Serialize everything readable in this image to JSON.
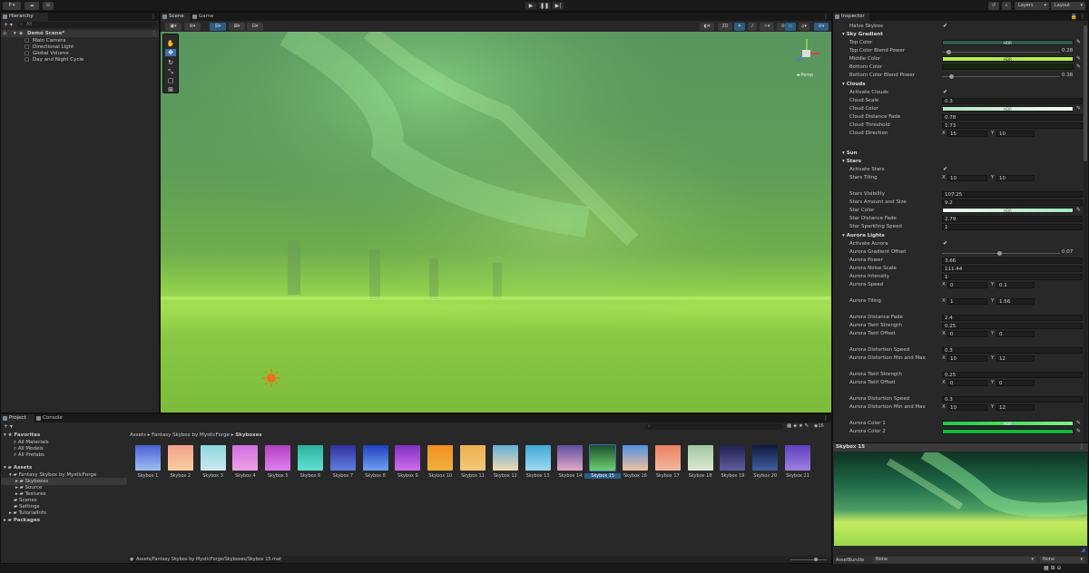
{
  "toolbar": {
    "account_label": "P",
    "layers_label": "Layers",
    "layout_label": "Layout"
  },
  "hierarchy": {
    "tab": "Hierarchy",
    "search_placeholder": "All",
    "scene": "Demo Scene*",
    "items": [
      "Main Camera",
      "Directional Light",
      "Global Volume",
      "Day and Night Cycle"
    ]
  },
  "scene_tabs": {
    "scene": "Scene",
    "game": "Game"
  },
  "scene_toolbar": {
    "mode_2d": "2D",
    "orient": "◄ Persp"
  },
  "project": {
    "tabs": [
      "Project",
      "Console"
    ],
    "favorites_label": "Favorites",
    "favorites": [
      "All Materials",
      "All Models",
      "All Prefabs"
    ],
    "assets_label": "Assets",
    "assets_tree": [
      "Fantasy Skybox by MysticForge",
      "Skyboxes",
      "Source",
      "Textures",
      "Scenes",
      "Settings",
      "TutorialInfo"
    ],
    "packages_label": "Packages",
    "breadcrumb": [
      "Assets",
      "Fantasy Skybox by MysticForge",
      "Skyboxes"
    ],
    "hidden_count": "16",
    "status_path": "Assets/Fantasy Skybox by MysticForge/Skyboxes/Skybox 15.mat"
  },
  "skyboxes": [
    {
      "name": "Skybox 1",
      "c1": "#4a60d8",
      "c2": "#9cc0f0"
    },
    {
      "name": "Skybox 2",
      "c1": "#f4a08a",
      "c2": "#f7d0a0"
    },
    {
      "name": "Skybox 3",
      "c1": "#8ad8e0",
      "c2": "#d0e8f0"
    },
    {
      "name": "Skybox 4",
      "c1": "#d070e0",
      "c2": "#f0a0e8"
    },
    {
      "name": "Skybox 5",
      "c1": "#b040c0",
      "c2": "#e080f0"
    },
    {
      "name": "Skybox 6",
      "c1": "#30b0a0",
      "c2": "#60e0d0"
    },
    {
      "name": "Skybox 7",
      "c1": "#3030a0",
      "c2": "#6080e0"
    },
    {
      "name": "Skybox 8",
      "c1": "#2040c0",
      "c2": "#70a0f0"
    },
    {
      "name": "Skybox 9",
      "c1": "#8030c0",
      "c2": "#d070f0"
    },
    {
      "name": "Skybox 10",
      "c1": "#f09020",
      "c2": "#f0b040"
    },
    {
      "name": "Skybox 11",
      "c1": "#f0b050",
      "c2": "#f0c878"
    },
    {
      "name": "Skybox 12",
      "c1": "#60b0d8",
      "c2": "#f0d8b0"
    },
    {
      "name": "Skybox 13",
      "c1": "#40a8d8",
      "c2": "#a0d8f0"
    },
    {
      "name": "Skybox 14",
      "c1": "#6050a0",
      "c2": "#e0a8c8"
    },
    {
      "name": "Skybox 15",
      "c1": "#1a5030",
      "c2": "#70d070"
    },
    {
      "name": "Skybox 16",
      "c1": "#5090e0",
      "c2": "#f0c0a0"
    },
    {
      "name": "Skybox 17",
      "c1": "#f08060",
      "c2": "#f0b8a0"
    },
    {
      "name": "Skybox 18",
      "c1": "#a0c8a0",
      "c2": "#e0e8d0"
    },
    {
      "name": "Skybox 19",
      "c1": "#202050",
      "c2": "#6060a0"
    },
    {
      "name": "Skybox 20",
      "c1": "#101840",
      "c2": "#4060a0"
    },
    {
      "name": "Skybox 21",
      "c1": "#6040c0",
      "c2": "#a080e0"
    }
  ],
  "inspector": {
    "tab": "Inspector",
    "halve": "Halve Skybox",
    "sky_gradient": "Sky Gradient",
    "top_color": "Top Color",
    "top_color_hdr": "HDR",
    "top_blend": "Top Color Blend Power",
    "top_blend_val": "0.28",
    "top_blend_frac": 0.04,
    "middle_color": "Middle Color",
    "middle_color_hdr": "HDR",
    "bottom_color": "Bottom Color",
    "bottom_blend": "Bottom Color Blend Power",
    "bottom_blend_val": "0.38",
    "bottom_blend_frac": 0.06,
    "clouds": "Clouds",
    "activate_clouds": "Activate Clouds",
    "cloud_scale": "Cloud Scale",
    "cloud_scale_val": "0.3",
    "cloud_color": "Cloud Color",
    "cloud_color_hdr": "HDR",
    "cloud_fade": "Cloud Distance Fade",
    "cloud_fade_val": "0.78",
    "cloud_threshold": "Cloud Threshold",
    "cloud_threshold_val": "1.73",
    "cloud_dir": "Cloud Direction",
    "cloud_dir_x": "15",
    "cloud_dir_y": "10",
    "sun": "Sun",
    "stars": "Stars",
    "activate_stars": "Activate Stars",
    "stars_tiling": "Stars Tiling",
    "stars_tiling_x": "10",
    "stars_tiling_y": "10",
    "stars_visibility": "Stars Visibility",
    "stars_visibility_val": "107.25",
    "stars_amount": "Stars Amount and Size",
    "stars_amount_val": "9.2",
    "star_color": "Star Color",
    "star_color_hdr": "HDR",
    "star_fade": "Star Distance Fade",
    "star_fade_val": "2.79",
    "star_sparkle": "Star Sparkling Speed",
    "star_sparkle_val": "1",
    "aurora_lights": "Aurora Lights",
    "activate_aurora": "Activate Aurora",
    "aurora_grad": "Aurora Gradient Offset",
    "aurora_grad_val": "0.07",
    "aurora_grad_frac": 0.47,
    "aurora_power": "Aurora Power",
    "aurora_power_val": "3.66",
    "aurora_noise": "Aurora Noise Scale",
    "aurora_noise_val": "111.44",
    "aurora_intensity": "Aurora Intensity",
    "aurora_intensity_val": "1",
    "aurora_speed": "Aurora Speed",
    "aurora_speed_x": "0",
    "aurora_speed_y": "0.1",
    "aurora_tiling": "Aurora Tiling",
    "aurora_tiling_x": "1",
    "aurora_tiling_y": "1.56",
    "aurora_fade": "Aurora Distance Fade",
    "aurora_fade_val": "2.4",
    "aurora_twirl": "Aurora Twirl Strength",
    "aurora_twirl_val": "0.25",
    "aurora_twirl_off": "Aurora Twirl Offset",
    "aurora_twirl_off_x": "0",
    "aurora_twirl_off_y": "0",
    "aurora_dist_speed": "Aurora Distortion Speed",
    "aurora_dist_speed_val": "0.3",
    "aurora_dist_mm": "Aurora Distortion Min and Max",
    "aurora_dist_mm_x": "10",
    "aurora_dist_mm_y": "12",
    "aurora_twirl2": "Aurora Twirl Strength",
    "aurora_twirl2_val": "0.25",
    "aurora_twirl_off2": "Aurora Twirl Offset",
    "aurora_twirl_off2_x": "0",
    "aurora_twirl_off2_y": "0",
    "aurora_dist_speed2": "Aurora Distortion Speed",
    "aurora_dist_speed2_val": "0.3",
    "aurora_dist_mm2": "Aurora Distortion Min and Max",
    "aurora_dist_mm2_x": "10",
    "aurora_dist_mm2_y": "12",
    "aurora_color1": "Aurora Color 1",
    "aurora_color1_hdr": "HDR",
    "aurora_color2": "Aurora Color 2",
    "x": "X",
    "y": "Y",
    "preview_title": "Skybox 15",
    "assetbundle": "AssetBundle",
    "ab_none1": "None",
    "ab_none2": "None"
  },
  "colors": {
    "accent": "#3d6fb5",
    "selected": "#2c5d87"
  }
}
